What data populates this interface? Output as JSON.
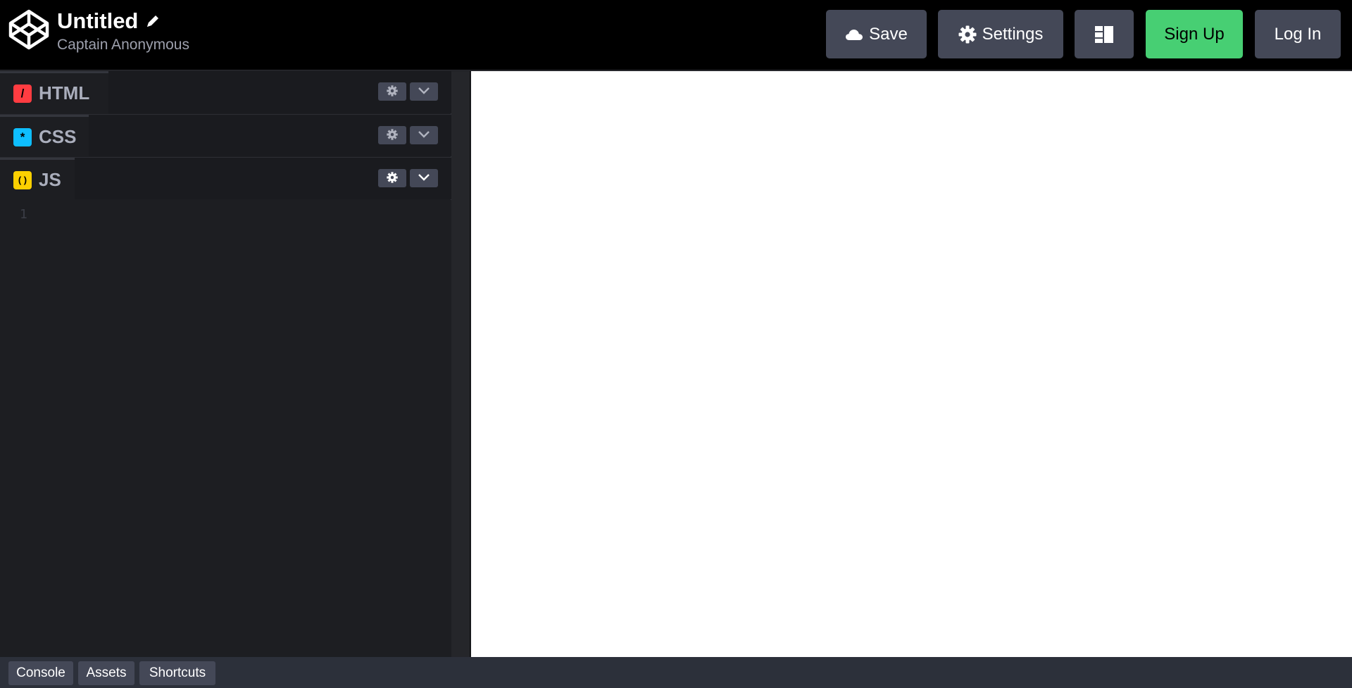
{
  "header": {
    "title": "Untitled",
    "author": "Captain Anonymous",
    "buttons": {
      "save": "Save",
      "settings": "Settings",
      "signup": "Sign Up",
      "login": "Log In"
    },
    "icons": {
      "logo": "codepen-logo-icon",
      "edit": "pencil-icon",
      "save": "cloud-icon",
      "settings": "gear-icon",
      "layout": "layout-icon"
    }
  },
  "editors": [
    {
      "name": "HTML",
      "badge_symbol": "/",
      "badge_color": "#ff3c41"
    },
    {
      "name": "CSS",
      "badge_symbol": "*",
      "badge_color": "#0ebeff"
    },
    {
      "name": "JS",
      "badge_symbol": "( )",
      "badge_color": "#fcd000"
    }
  ],
  "code": {
    "line_numbers": [
      "1"
    ]
  },
  "footer": {
    "buttons": [
      "Console",
      "Assets",
      "Shortcuts"
    ]
  },
  "colors": {
    "header_bg": "#000000",
    "button_bg": "#444857",
    "signup_bg": "#47cf73",
    "editor_bg": "#1d1e22",
    "footer_bg": "#2c303a",
    "preview_bg": "#ffffff"
  }
}
